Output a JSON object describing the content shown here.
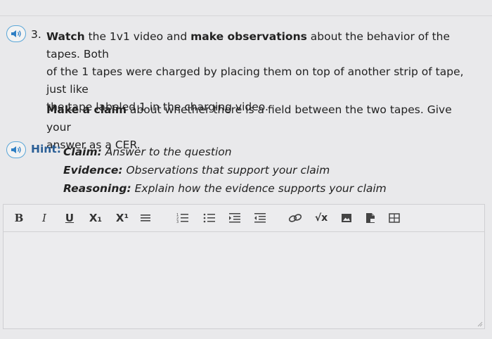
{
  "question": {
    "number": "3.",
    "line1_parts": [
      "Watch",
      " the 1v1 video and ",
      "make observations",
      " about the behavior of the tapes. Both"
    ],
    "line2": "of the 1 tapes were charged by placing them on top of another strip of tape, just like",
    "line3": "the tape labeled 1 in the charging video.",
    "claim_bold": "Make a claim",
    "claim_rest1": " about whether there is a field between the two tapes. Give your",
    "claim_rest2": "answer as a CER."
  },
  "hint": {
    "label": "Hint:",
    "claim_label": "Claim:",
    "claim_text": " Answer to the question",
    "evidence_label": "Evidence:",
    "evidence_text": " Observations that support your claim",
    "reasoning_label": "Reasoning:",
    "reasoning_text": " Explain how the evidence supports your claim"
  },
  "toolbar": {
    "bold": "B",
    "italic": "I",
    "underline": "U",
    "subscript": "X₁",
    "superscript": "X¹",
    "sqrt": "√x"
  },
  "colors": {
    "accent": "#5aa6d8",
    "hint": "#2b5f96"
  }
}
